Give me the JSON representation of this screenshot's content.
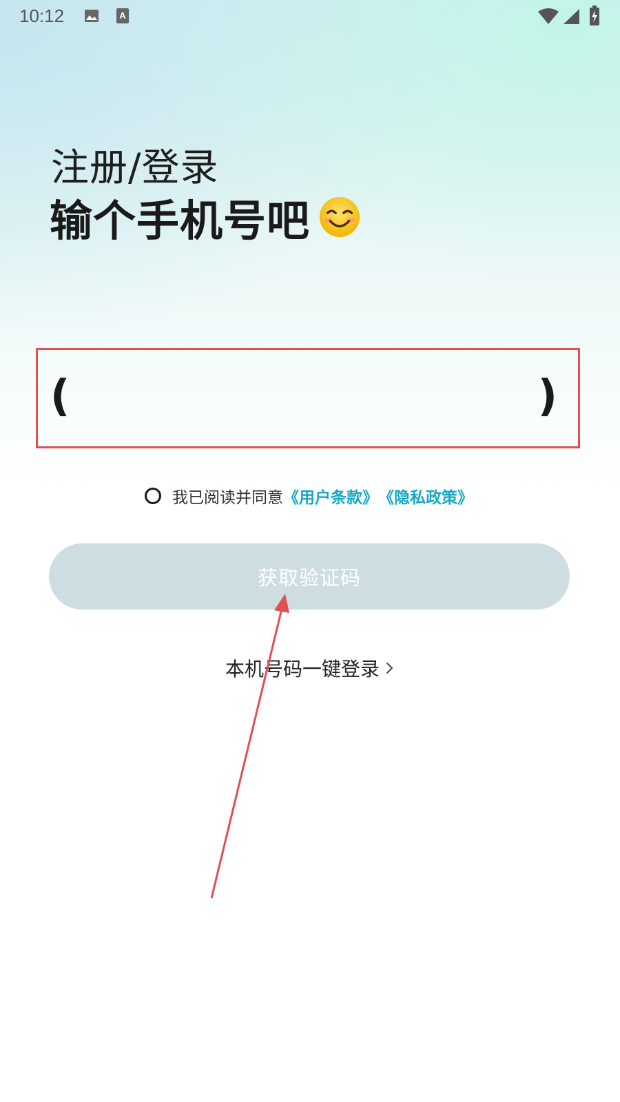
{
  "status_bar": {
    "time": "10:12",
    "icons": [
      "image-icon",
      "a-text-icon",
      "wifi-icon",
      "signal-icon",
      "battery-charging-icon"
    ]
  },
  "header": {
    "title_small": "注册/登录",
    "title_big": "输个手机号吧",
    "emoji_icon": "smiling-face-emoji"
  },
  "phone_input": {
    "left_paren": "(",
    "right_paren": ")",
    "value": "",
    "placeholder": ""
  },
  "agreement": {
    "prefix": "我已阅读并同意",
    "terms_link": "《用户条款》",
    "privacy_link": "《隐私政策》",
    "checked": false
  },
  "actions": {
    "get_code_label": "获取验证码",
    "one_click_label": "本机号码一键登录"
  },
  "colors": {
    "accent_link": "#16a8c4",
    "button_disabled": "#cddde1",
    "annotation_red": "#e05050"
  }
}
